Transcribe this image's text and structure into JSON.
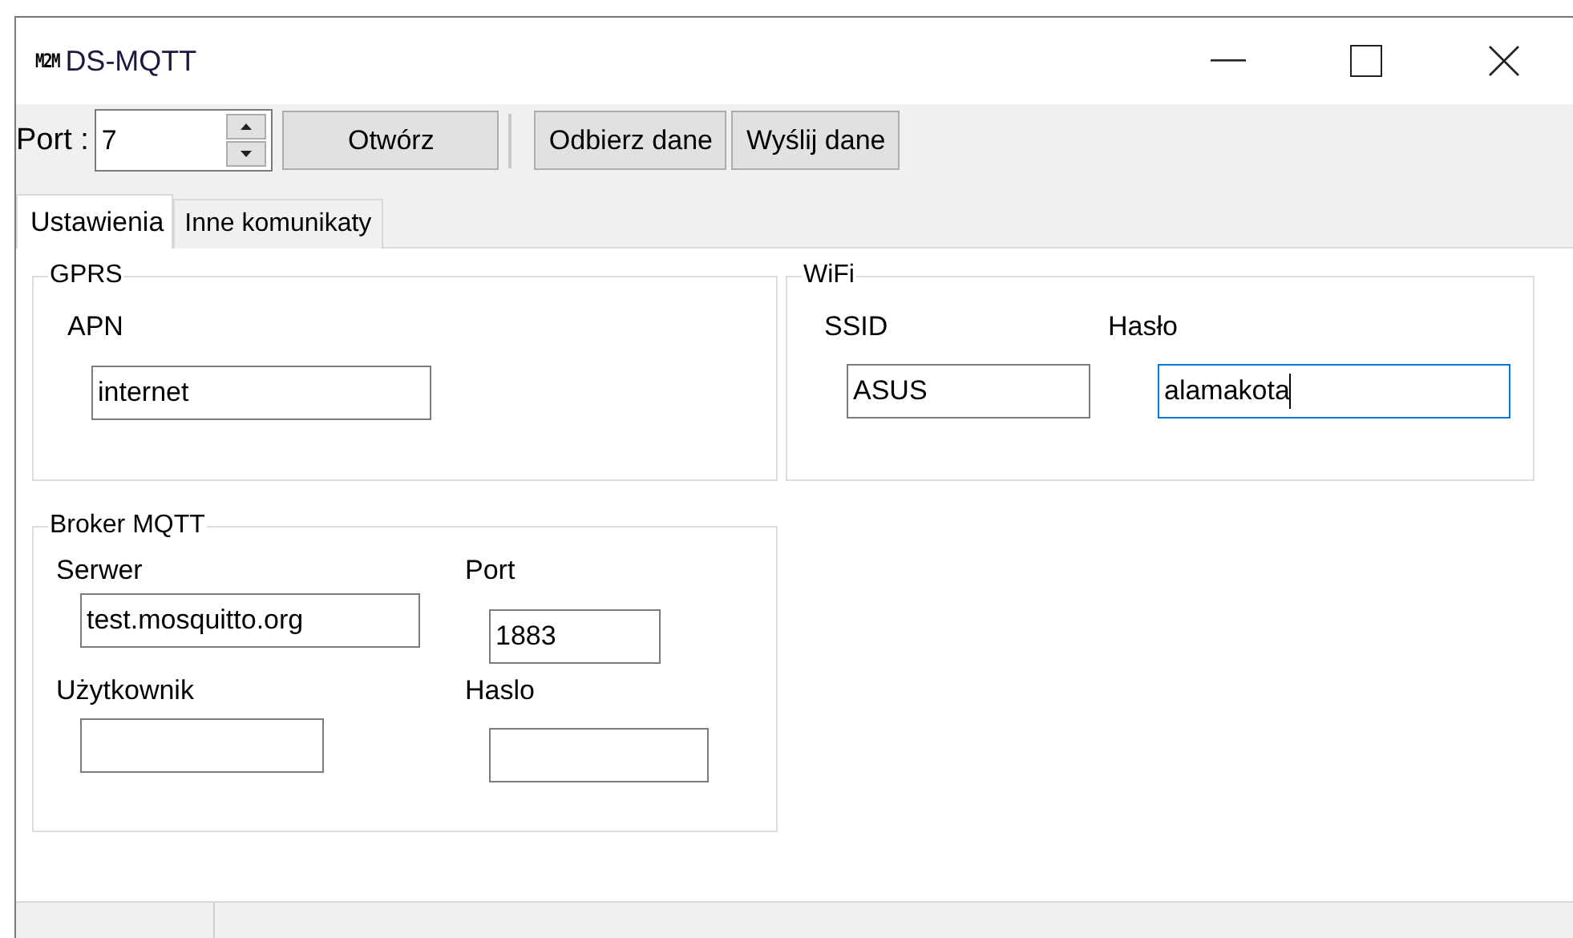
{
  "window": {
    "logo": "M2M",
    "title": "DS-MQTT"
  },
  "toolbar": {
    "port_label": "Port :",
    "port_value": "7",
    "buttons": [
      "Otwórz",
      "Odbierz dane",
      "Wyślij dane"
    ]
  },
  "tabs": [
    {
      "label": "Ustawienia",
      "selected": true
    },
    {
      "label": "Inne komunikaty",
      "selected": false
    }
  ],
  "groups": [
    {
      "title": "GPRS",
      "fields": [
        {
          "label": "APN",
          "value": "internet",
          "focused": false
        }
      ]
    },
    {
      "title": "WiFi",
      "fields": [
        {
          "label": "SSID",
          "value": "ASUS",
          "focused": false
        },
        {
          "label": "Hasło",
          "value": "alamakota",
          "focused": true
        }
      ]
    },
    {
      "title": "Broker MQTT",
      "fields": [
        {
          "label": "Serwer",
          "value": "test.mosquitto.org",
          "focused": false
        },
        {
          "label": "Port",
          "value": "1883",
          "focused": false
        },
        {
          "label": "Użytkownik",
          "focused": false
        },
        {
          "label": "Haslo",
          "focused": false
        }
      ]
    }
  ]
}
